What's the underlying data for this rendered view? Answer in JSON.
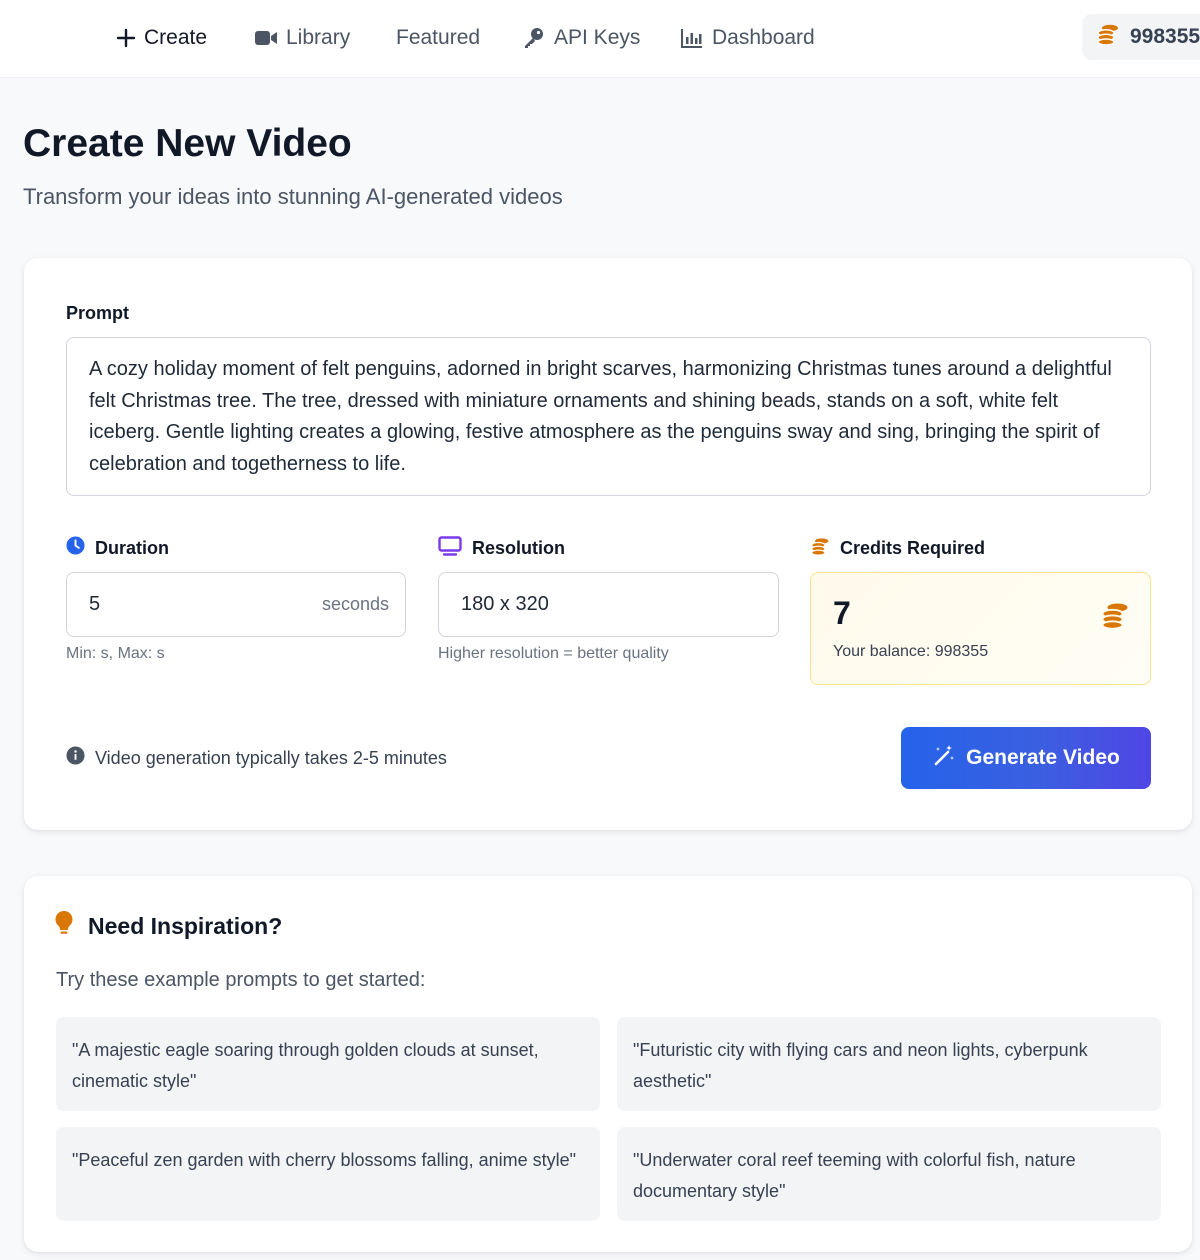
{
  "nav": {
    "items": [
      {
        "label": "Create",
        "icon": "plus-icon"
      },
      {
        "label": "Library",
        "icon": "video-camera-icon"
      },
      {
        "label": "Featured",
        "icon": ""
      },
      {
        "label": "API Keys",
        "icon": "key-icon"
      },
      {
        "label": "Dashboard",
        "icon": "bar-chart-icon"
      }
    ],
    "credits_balance": "998355",
    "credits_icon": "coins-icon"
  },
  "header": {
    "title": "Create New Video",
    "subtitle": "Transform your ideas into stunning AI-generated videos"
  },
  "form": {
    "prompt_label": "Prompt",
    "prompt_value": "A cozy holiday moment of felt penguins, adorned in bright scarves, harmonizing Christmas tunes around a delightful felt Christmas tree. The tree, dressed with miniature ornaments and shining beads, stands on a soft, white felt iceberg. Gentle lighting creates a glowing, festive atmosphere as the penguins sway and sing, bringing the spirit of celebration and togetherness to life.",
    "duration": {
      "label": "Duration",
      "icon": "clock-icon",
      "value": "5",
      "unit": "seconds",
      "hint": "Min: s, Max: s"
    },
    "resolution": {
      "label": "Resolution",
      "icon": "monitor-icon",
      "value": "180 x 320",
      "hint": "Higher resolution = better quality"
    },
    "credits": {
      "label": "Credits Required",
      "icon": "coins-icon",
      "value": "7",
      "balance_text": "Your balance: 998355"
    },
    "info_text": "Video generation typically takes 2-5 minutes",
    "generate_label": "Generate Video"
  },
  "inspiration": {
    "title": "Need Inspiration?",
    "subtitle": "Try these example prompts to get started:",
    "examples": [
      "\"A majestic eagle soaring through golden clouds at sunset, cinematic style\"",
      "\"Futuristic city with flying cars and neon lights, cyberpunk aesthetic\"",
      "\"Peaceful zen garden with cherry blossoms falling, anime style\"",
      "\"Underwater coral reef teeming with colorful fish, nature documentary style\""
    ]
  },
  "colors": {
    "accent_blue": "#2563eb",
    "accent_indigo": "#4f46e5",
    "coin_gold": "#d97706",
    "resolution_purple": "#7c3aed",
    "credits_border": "#fbe38a"
  }
}
